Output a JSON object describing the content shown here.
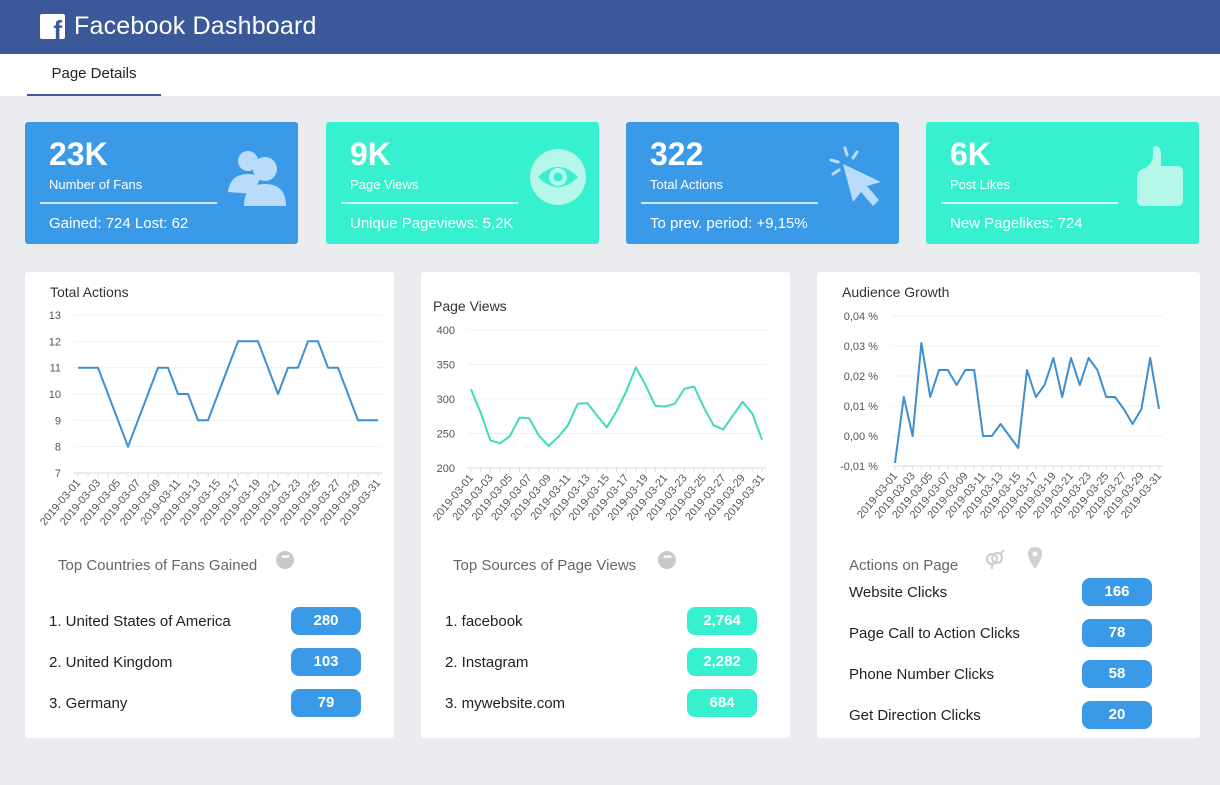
{
  "header": {
    "title": "Facebook Dashboard",
    "logo_icon": "facebook-logo-icon"
  },
  "tabs": [
    {
      "label": "Page Details",
      "active": true
    }
  ],
  "colors": {
    "header": "#3b5998",
    "blue": "#3b9ae8",
    "teal": "#36f0cf",
    "background": "#ebecf0"
  },
  "kpis": [
    {
      "value": "23K",
      "label": "Number of Fans",
      "sub": "Gained: 724  Lost: 62",
      "icon": "users-icon",
      "color": "blue"
    },
    {
      "value": "9K",
      "label": "Page Views",
      "sub": "Unique Pageviews: 5,2K",
      "icon": "eye-icon",
      "color": "teal"
    },
    {
      "value": "322",
      "label": "Total Actions",
      "sub": "To prev. period: +9,15%",
      "icon": "cursor-click-icon",
      "color": "blue"
    },
    {
      "value": "6K",
      "label": "Post Likes",
      "sub": "New Pagelikes: 724",
      "icon": "thumbs-up-icon",
      "color": "teal"
    }
  ],
  "chart_data": [
    {
      "type": "line",
      "title": "Total Actions",
      "xlabel": "",
      "ylabel": "",
      "x": [
        "2019-03-01",
        "2019-03-02",
        "2019-03-03",
        "2019-03-04",
        "2019-03-05",
        "2019-03-06",
        "2019-03-07",
        "2019-03-08",
        "2019-03-09",
        "2019-03-10",
        "2019-03-11",
        "2019-03-12",
        "2019-03-13",
        "2019-03-14",
        "2019-03-15",
        "2019-03-16",
        "2019-03-17",
        "2019-03-18",
        "2019-03-19",
        "2019-03-20",
        "2019-03-21",
        "2019-03-22",
        "2019-03-23",
        "2019-03-24",
        "2019-03-25",
        "2019-03-26",
        "2019-03-27",
        "2019-03-28",
        "2019-03-29",
        "2019-03-30",
        "2019-03-31"
      ],
      "x_tick_labels": [
        "2019-03-01",
        "2019-03-03",
        "2019-03-05",
        "2019-03-07",
        "2019-03-09",
        "2019-03-11",
        "2019-03-13",
        "2019-03-15",
        "2019-03-17",
        "2019-03-19",
        "2019-03-21",
        "2019-03-23",
        "2019-03-25",
        "2019-03-27",
        "2019-03-29",
        "2019-03-31"
      ],
      "series": [
        {
          "name": "Total Actions",
          "color": "#3d8fd0",
          "values": [
            11,
            11,
            11,
            10,
            9,
            8,
            9,
            10,
            11,
            11,
            10,
            10,
            9,
            9,
            10,
            11,
            12,
            12,
            12,
            11,
            10,
            11,
            11,
            12,
            12,
            11,
            11,
            10,
            9,
            9,
            9
          ]
        }
      ],
      "ylim": [
        7,
        13
      ],
      "y_ticks": [
        7,
        8,
        9,
        10,
        11,
        12,
        13
      ],
      "y_tick_labels": [
        "7",
        "8",
        "9",
        "10",
        "11",
        "12",
        "13"
      ],
      "grid": true
    },
    {
      "type": "line",
      "title": "Page Views",
      "xlabel": "",
      "ylabel": "",
      "x": [
        "2019-03-01",
        "2019-03-02",
        "2019-03-03",
        "2019-03-04",
        "2019-03-05",
        "2019-03-06",
        "2019-03-07",
        "2019-03-08",
        "2019-03-09",
        "2019-03-10",
        "2019-03-11",
        "2019-03-12",
        "2019-03-13",
        "2019-03-14",
        "2019-03-15",
        "2019-03-16",
        "2019-03-17",
        "2019-03-18",
        "2019-03-19",
        "2019-03-20",
        "2019-03-21",
        "2019-03-22",
        "2019-03-23",
        "2019-03-24",
        "2019-03-25",
        "2019-03-26",
        "2019-03-27",
        "2019-03-28",
        "2019-03-29",
        "2019-03-30",
        "2019-03-31"
      ],
      "x_tick_labels": [
        "2019-03-01",
        "2019-03-03",
        "2019-03-05",
        "2019-03-07",
        "2019-03-09",
        "2019-03-11",
        "2019-03-13",
        "2019-03-15",
        "2019-03-17",
        "2019-03-19",
        "2019-03-21",
        "2019-03-23",
        "2019-03-25",
        "2019-03-27",
        "2019-03-29",
        "2019-03-31"
      ],
      "series": [
        {
          "name": "Page Views",
          "color": "#3fdcb8",
          "values": [
            314,
            280,
            240,
            236,
            246,
            273,
            272,
            247,
            232,
            245,
            262,
            293,
            294,
            276,
            259,
            282,
            311,
            346,
            320,
            290,
            289,
            293,
            315,
            318,
            288,
            262,
            256,
            276,
            296,
            279,
            241
          ]
        }
      ],
      "ylim": [
        200,
        400
      ],
      "y_ticks": [
        200,
        250,
        300,
        350,
        400
      ],
      "y_tick_labels": [
        "200",
        "250",
        "300",
        "350",
        "400"
      ],
      "grid": true
    },
    {
      "type": "line",
      "title": "Audience Growth",
      "xlabel": "",
      "ylabel": "",
      "x": [
        "2019-03-01",
        "2019-03-02",
        "2019-03-03",
        "2019-03-04",
        "2019-03-05",
        "2019-03-06",
        "2019-03-07",
        "2019-03-08",
        "2019-03-09",
        "2019-03-10",
        "2019-03-11",
        "2019-03-12",
        "2019-03-13",
        "2019-03-14",
        "2019-03-15",
        "2019-03-16",
        "2019-03-17",
        "2019-03-18",
        "2019-03-19",
        "2019-03-20",
        "2019-03-21",
        "2019-03-22",
        "2019-03-23",
        "2019-03-24",
        "2019-03-25",
        "2019-03-26",
        "2019-03-27",
        "2019-03-28",
        "2019-03-29",
        "2019-03-30",
        "2019-03-31"
      ],
      "x_tick_labels": [
        "2019-03-01",
        "2019-03-03",
        "2019-03-05",
        "2019-03-07",
        "2019-03-09",
        "2019-03-11",
        "2019-03-13",
        "2019-03-15",
        "2019-03-17",
        "2019-03-19",
        "2019-03-21",
        "2019-03-23",
        "2019-03-25",
        "2019-03-27",
        "2019-03-29",
        "2019-03-31"
      ],
      "series": [
        {
          "name": "Audience Growth (%)",
          "color": "#3d8fd0",
          "values": [
            -0.009,
            0.013,
            0.0,
            0.031,
            0.013,
            0.022,
            0.022,
            0.017,
            0.022,
            0.022,
            0.0,
            0.0,
            0.004,
            0.0,
            -0.004,
            0.022,
            0.013,
            0.017,
            0.026,
            0.013,
            0.026,
            0.017,
            0.026,
            0.022,
            0.013,
            0.013,
            0.009,
            0.004,
            0.009,
            0.026,
            0.009
          ]
        }
      ],
      "ylim": [
        -0.01,
        0.04
      ],
      "y_ticks": [
        -0.01,
        0.0,
        0.01,
        0.02,
        0.03,
        0.04
      ],
      "y_tick_labels": [
        "-0,01 %",
        "0,00 %",
        "0,01 %",
        "0,02 %",
        "0,03 %",
        "0,04 %"
      ],
      "grid": true
    }
  ],
  "lists": [
    {
      "title": "Top Countries of Fans Gained",
      "header_icons": [
        "more-options-icon"
      ],
      "pill_color": "blue",
      "items": [
        {
          "label": "1. United States of America",
          "value": "280"
        },
        {
          "label": "2. United Kingdom",
          "value": "103"
        },
        {
          "label": "3. Germany",
          "value": "79"
        }
      ]
    },
    {
      "title": "Top Sources of Page Views",
      "header_icons": [
        "more-options-icon"
      ],
      "pill_color": "teal",
      "items": [
        {
          "label": "1. facebook",
          "value": "2,764"
        },
        {
          "label": "2. Instagram",
          "value": "2,282"
        },
        {
          "label": "3. mywebsite.com",
          "value": "684"
        }
      ]
    },
    {
      "title": "Actions on Page",
      "header_icons": [
        "gender-icon",
        "location-pin-icon"
      ],
      "pill_color": "blue",
      "items": [
        {
          "label": "Website Clicks",
          "value": "166"
        },
        {
          "label": "Page Call to Action Clicks",
          "value": "78"
        },
        {
          "label": "Phone Number Clicks",
          "value": "58"
        },
        {
          "label": "Get Direction Clicks",
          "value": "20"
        }
      ]
    }
  ]
}
